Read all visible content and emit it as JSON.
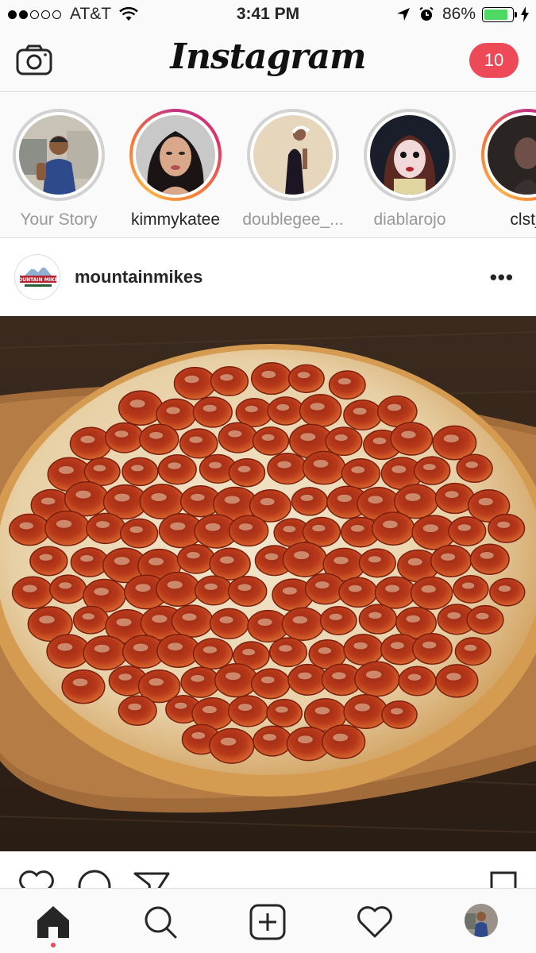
{
  "status_bar": {
    "carrier": "AT&T",
    "time": "3:41 PM",
    "battery_percent": "86%",
    "battery_level": 0.86,
    "signal_bars_filled": 2,
    "signal_bars_total": 5
  },
  "header": {
    "title": "Instagram",
    "direct_count": "10",
    "camera_icon": "camera-icon"
  },
  "stories": [
    {
      "label": "Your Story",
      "seen": true
    },
    {
      "label": "kimmykatee",
      "seen": false
    },
    {
      "label": "doublegee_...",
      "seen": true
    },
    {
      "label": "diablarojo",
      "seen": true
    },
    {
      "label": "clst_",
      "seen": false
    }
  ],
  "post": {
    "username": "mountainmikes",
    "avatar_logo_text": "MOUNTAIN MIKE'S",
    "more_label": "•••",
    "image_subject": "pepperoni pizza on wooden board"
  },
  "tabbar": {
    "items": [
      "home-icon",
      "search-icon",
      "add-icon",
      "activity-heart-icon",
      "profile-avatar"
    ],
    "active": "home-icon"
  },
  "colors": {
    "badge": "#ed4956",
    "story_ring_seen": "#d2d2d2",
    "story_ring_unseen": "#e1306c",
    "battery": "#4cd964"
  }
}
